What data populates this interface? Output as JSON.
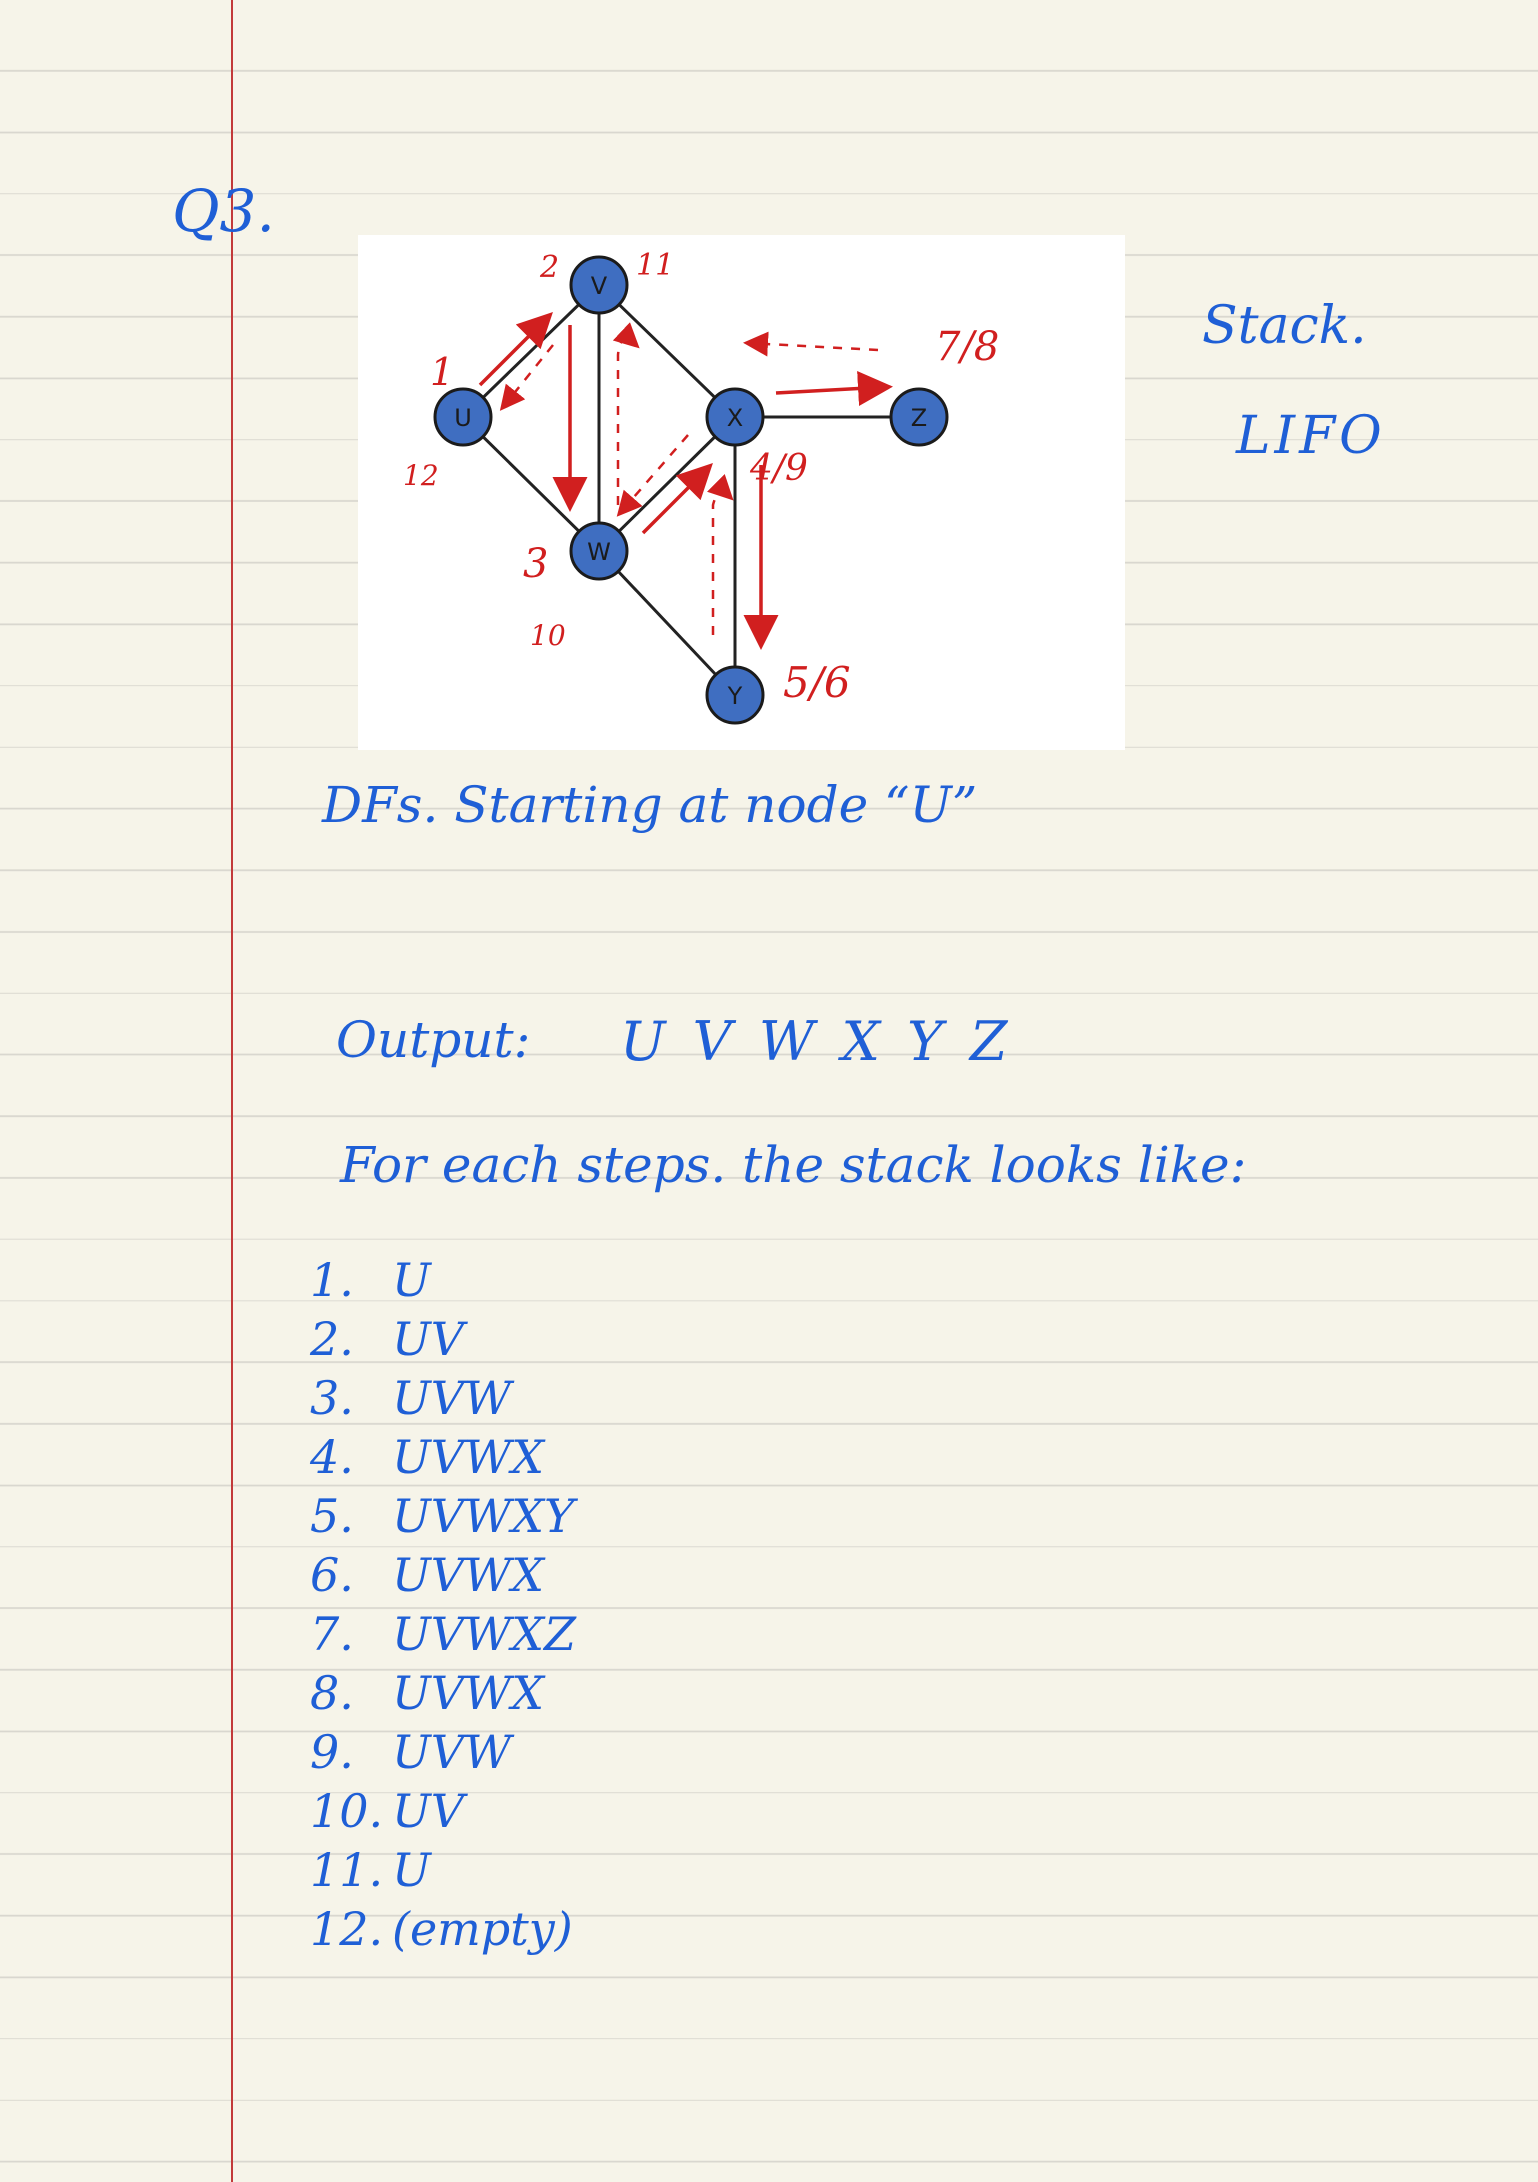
{
  "question": {
    "label": "Q3."
  },
  "diagram": {
    "colors": {
      "node_fill": "#3f6ec1",
      "edge": "#222222",
      "annotation": "#d11f1f",
      "ink": "#1f5fd6"
    },
    "nodes": [
      {
        "id": "U",
        "label": "U",
        "time": "1",
        "finish": "12"
      },
      {
        "id": "V",
        "label": "V",
        "time": "2",
        "finish": "11"
      },
      {
        "id": "W",
        "label": "W",
        "time": "3",
        "finish": "10"
      },
      {
        "id": "X",
        "label": "X",
        "time": "4/9"
      },
      {
        "id": "Y",
        "label": "Y",
        "time": "5/6"
      },
      {
        "id": "Z",
        "label": "Z",
        "time": "7/8"
      }
    ]
  },
  "side_notes": {
    "title": "Stack.",
    "lifo": "LIFO"
  },
  "caption": "DFs. Starting at node “U”",
  "output": {
    "label": "Output:",
    "value": "U V W X Y Z"
  },
  "steps_heading": "For each steps. the stack looks like:",
  "steps": [
    {
      "num": "1.",
      "stack": "U"
    },
    {
      "num": "2.",
      "stack": "UV"
    },
    {
      "num": "3.",
      "stack": "UVW"
    },
    {
      "num": "4.",
      "stack": "UVWX"
    },
    {
      "num": "5.",
      "stack": "UVWXY"
    },
    {
      "num": "6.",
      "stack": "UVWX"
    },
    {
      "num": "7.",
      "stack": "UVWXZ"
    },
    {
      "num": "8.",
      "stack": "UVWX"
    },
    {
      "num": "9.",
      "stack": "UVW"
    },
    {
      "num": "10.",
      "stack": "UV"
    },
    {
      "num": "11.",
      "stack": "U"
    },
    {
      "num": "12.",
      "stack": "(empty)"
    }
  ]
}
